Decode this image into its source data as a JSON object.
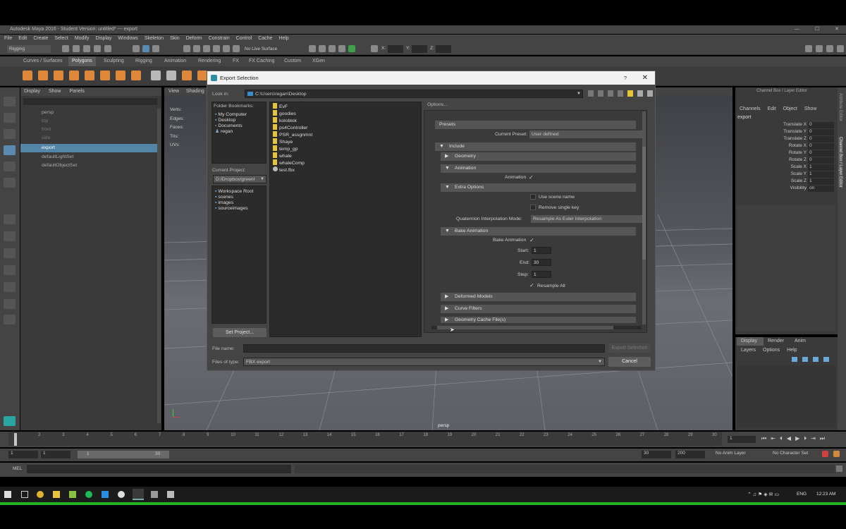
{
  "window": {
    "title": "Autodesk Maya 2016 - Student Version: untitled*  ---  export"
  },
  "menubar": [
    "File",
    "Edit",
    "Create",
    "Select",
    "Modify",
    "Display",
    "Windows",
    "Skeleton",
    "Skin",
    "Deform",
    "Constrain",
    "Control",
    "Cache",
    "Help"
  ],
  "statusline": {
    "mode": "Rigging",
    "live_surface": "No Live Surface",
    "x_label": "X:",
    "y_label": "Y:",
    "z_label": "Z:"
  },
  "shelf_tabs": [
    "Curves / Surfaces",
    "Polygons",
    "Sculpting",
    "Rigging",
    "Animation",
    "Rendering",
    "FX",
    "FX Caching",
    "Custom",
    "XGen"
  ],
  "outliner": {
    "menu": [
      "Display",
      "Show",
      "Panels"
    ],
    "items": [
      "persp",
      "top",
      "front",
      "side",
      "export",
      "defaultLightSet",
      "defaultObjectSet"
    ]
  },
  "viewport": {
    "menu": [
      "View",
      "Shading"
    ],
    "hud": [
      "Verts:",
      "Edges:",
      "Faces:",
      "Tris:",
      "UVs:"
    ],
    "camera_label": "persp"
  },
  "channelbox": {
    "header": "Channel Box / Layer Editor",
    "menu": [
      "Channels",
      "Edit",
      "Object",
      "Show"
    ],
    "object": "export",
    "attrs": [
      {
        "name": "Translate X",
        "value": "0"
      },
      {
        "name": "Translate Y",
        "value": "0"
      },
      {
        "name": "Translate Z",
        "value": "0"
      },
      {
        "name": "Rotate X",
        "value": "0"
      },
      {
        "name": "Rotate Y",
        "value": "0"
      },
      {
        "name": "Rotate Z",
        "value": "0"
      },
      {
        "name": "Scale X",
        "value": "1"
      },
      {
        "name": "Scale Y",
        "value": "1"
      },
      {
        "name": "Scale Z",
        "value": "1"
      },
      {
        "name": "Visibility",
        "value": "on"
      }
    ],
    "side_tabs": [
      "Attribute Editor",
      "Channel Box / Layer Editor"
    ]
  },
  "layer_editor": {
    "tabs": [
      "Display",
      "Render",
      "Anim"
    ],
    "menu": [
      "Layers",
      "Options",
      "Help"
    ]
  },
  "timeline": {
    "ticks": [
      "1",
      "2",
      "3",
      "4",
      "5",
      "6",
      "7",
      "8",
      "9",
      "10",
      "11",
      "12",
      "13",
      "14",
      "15",
      "16",
      "17",
      "18",
      "19",
      "20",
      "21",
      "22",
      "23",
      "24",
      "25",
      "26",
      "27",
      "28",
      "29",
      "30"
    ],
    "current": "1"
  },
  "range": {
    "start": "1",
    "start2": "1",
    "slider_start": "1",
    "slider_end": "30",
    "end": "30",
    "end2": "200",
    "anim_layer": "No Anim Layer",
    "char_set": "No Character Set"
  },
  "mel": {
    "label": "MEL"
  },
  "taskbar": {
    "lang": "ENG",
    "time": "12:23 AM"
  },
  "dialog": {
    "title": "Export Selection",
    "help": "?",
    "close": "✕",
    "look_in_label": "Look in:",
    "look_in_path": "C:\\Users\\regan\\Desktop",
    "bookmarks_label": "Folder Bookmarks:",
    "bookmarks": [
      "My Computer",
      "Desktop",
      "Documents",
      "regan"
    ],
    "project_label": "Current Project:",
    "project_value": "D:/Dropbox/greenl",
    "project_items": [
      "Workspace Root",
      "scenes",
      "images",
      "sourceimages"
    ],
    "set_project": "Set Project...",
    "files": [
      "EvF",
      "goodies",
      "koloblok",
      "ps4Controller",
      "PSR_assgnmnt",
      "Shaye",
      "temp_gp",
      "whale",
      "whaleComp",
      "test.fbx"
    ],
    "options_label": "Options...",
    "presets": {
      "title": "Presets",
      "current_label": "Current Preset:",
      "current_value": "User defined"
    },
    "include": "Include",
    "geometry": "Geometry",
    "animation": "Animation",
    "animation_cb": "Animation",
    "extra_options": "Extra Options",
    "use_scene_name": "Use scene name",
    "remove_single_key": "Remove single key",
    "quaternion_label": "Quaternion Interpolation Mode:",
    "quaternion_value": "Resample As Euler Interpolation",
    "bake_animation": "Bake Animation",
    "bake_cb": "Bake Animation",
    "start_label": "Start:",
    "start_value": "1",
    "end_label": "End:",
    "end_value": "30",
    "step_label": "Step:",
    "step_value": "1",
    "resample_all": "Resample All",
    "deformed_models": "Deformed Models",
    "curve_filters": "Curve Filters",
    "geometry_cache": "Geometry Cache File(s)",
    "file_name_label": "File name:",
    "file_name_value": "",
    "export_button": "Export Selection",
    "file_type_label": "Files of type:",
    "file_type_value": "FBX export",
    "cancel_button": "Cancel"
  }
}
